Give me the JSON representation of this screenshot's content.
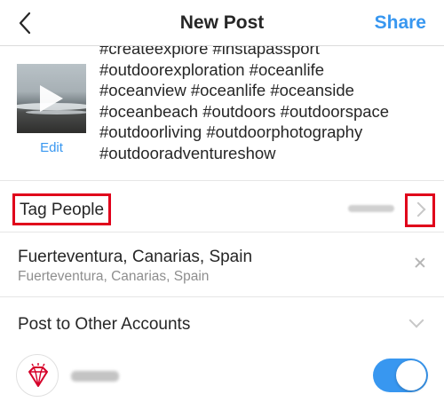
{
  "header": {
    "title": "New Post",
    "share_label": "Share"
  },
  "caption": {
    "edit_label": "Edit",
    "text": "#createexplore #instapassport\n#outdoorexploration #oceanlife\n#oceanview #oceanlife #oceanside\n#oceanbeach #outdoors #outdoorspace\n#outdoorliving #outdoorphotography\n#outdooradventureshow"
  },
  "tag_people": {
    "label": "Tag People"
  },
  "location": {
    "title": "Fuerteventura, Canarias, Spain",
    "subtitle": "Fuerteventura, Canarias, Spain"
  },
  "post_to_other": {
    "label": "Post to Other Accounts"
  },
  "account": {
    "toggle_on": true
  },
  "colors": {
    "accent": "#3897f0",
    "highlight": "#e0001b",
    "text": "#262626",
    "secondary_text": "#8e8e8e"
  },
  "icons": {
    "back": "chevron-left-icon",
    "play": "play-icon",
    "tag_arrow": "chevron-right-icon",
    "remove_location": "close-icon",
    "expand": "chevron-down-icon",
    "account_logo": "diamond-logo-icon"
  }
}
